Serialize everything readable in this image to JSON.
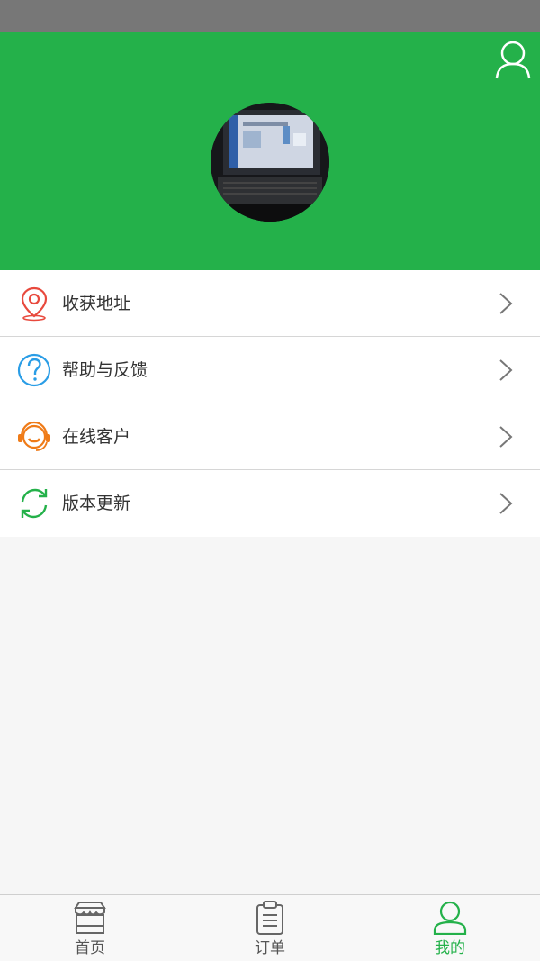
{
  "header": {
    "background": "#24b14a",
    "profile_icon": "user-outline-icon",
    "avatar_image": "laptop-photo"
  },
  "menu": {
    "items": [
      {
        "label": "收获地址",
        "icon": "location-pin-icon",
        "icon_color": "#e8493d"
      },
      {
        "label": "帮助与反馈",
        "icon": "question-circle-icon",
        "icon_color": "#2a9de6"
      },
      {
        "label": "在线客户",
        "icon": "headset-icon",
        "icon_color": "#ef7b18"
      },
      {
        "label": "版本更新",
        "icon": "refresh-icon",
        "icon_color": "#24b14a"
      }
    ]
  },
  "tabbar": {
    "tabs": [
      {
        "label": "首页",
        "icon": "store-icon",
        "active": false
      },
      {
        "label": "订单",
        "icon": "clipboard-icon",
        "active": false
      },
      {
        "label": "我的",
        "icon": "user-icon",
        "active": true
      }
    ],
    "active_color": "#24b14a"
  }
}
